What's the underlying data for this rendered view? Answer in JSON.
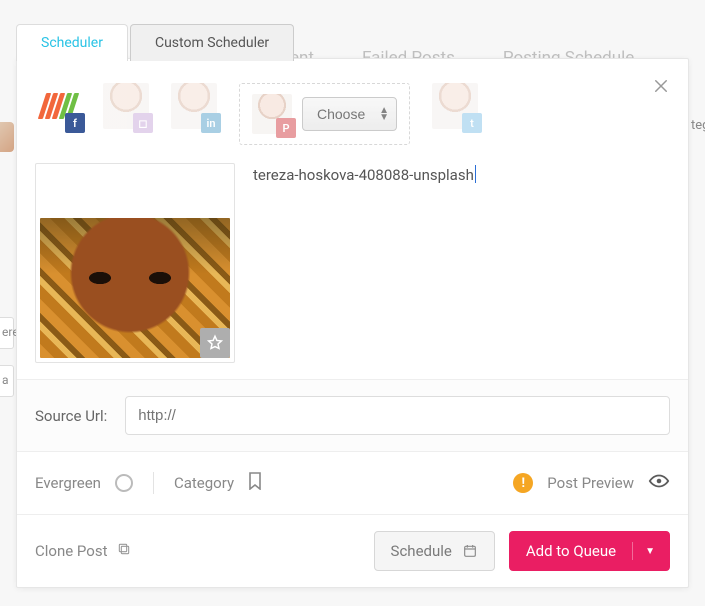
{
  "tabs": {
    "scheduler": "Scheduler",
    "custom": "Custom Scheduler"
  },
  "background_nav": {
    "item_partial": "ent",
    "failed": "Failed Posts",
    "schedule": "Posting Schedule",
    "right_partial": "teg",
    "left_partial_1": "ere",
    "left_partial_2": "a"
  },
  "compose": {
    "choose_label": "Choose",
    "caption": "tereza-hoskova-408088-unsplash"
  },
  "source": {
    "label": "Source Url:",
    "placeholder": "http://"
  },
  "options": {
    "evergreen": "Evergreen",
    "category": "Category",
    "preview": "Post Preview"
  },
  "actions": {
    "clone": "Clone Post",
    "schedule": "Schedule",
    "queue": "Add to Queue"
  }
}
